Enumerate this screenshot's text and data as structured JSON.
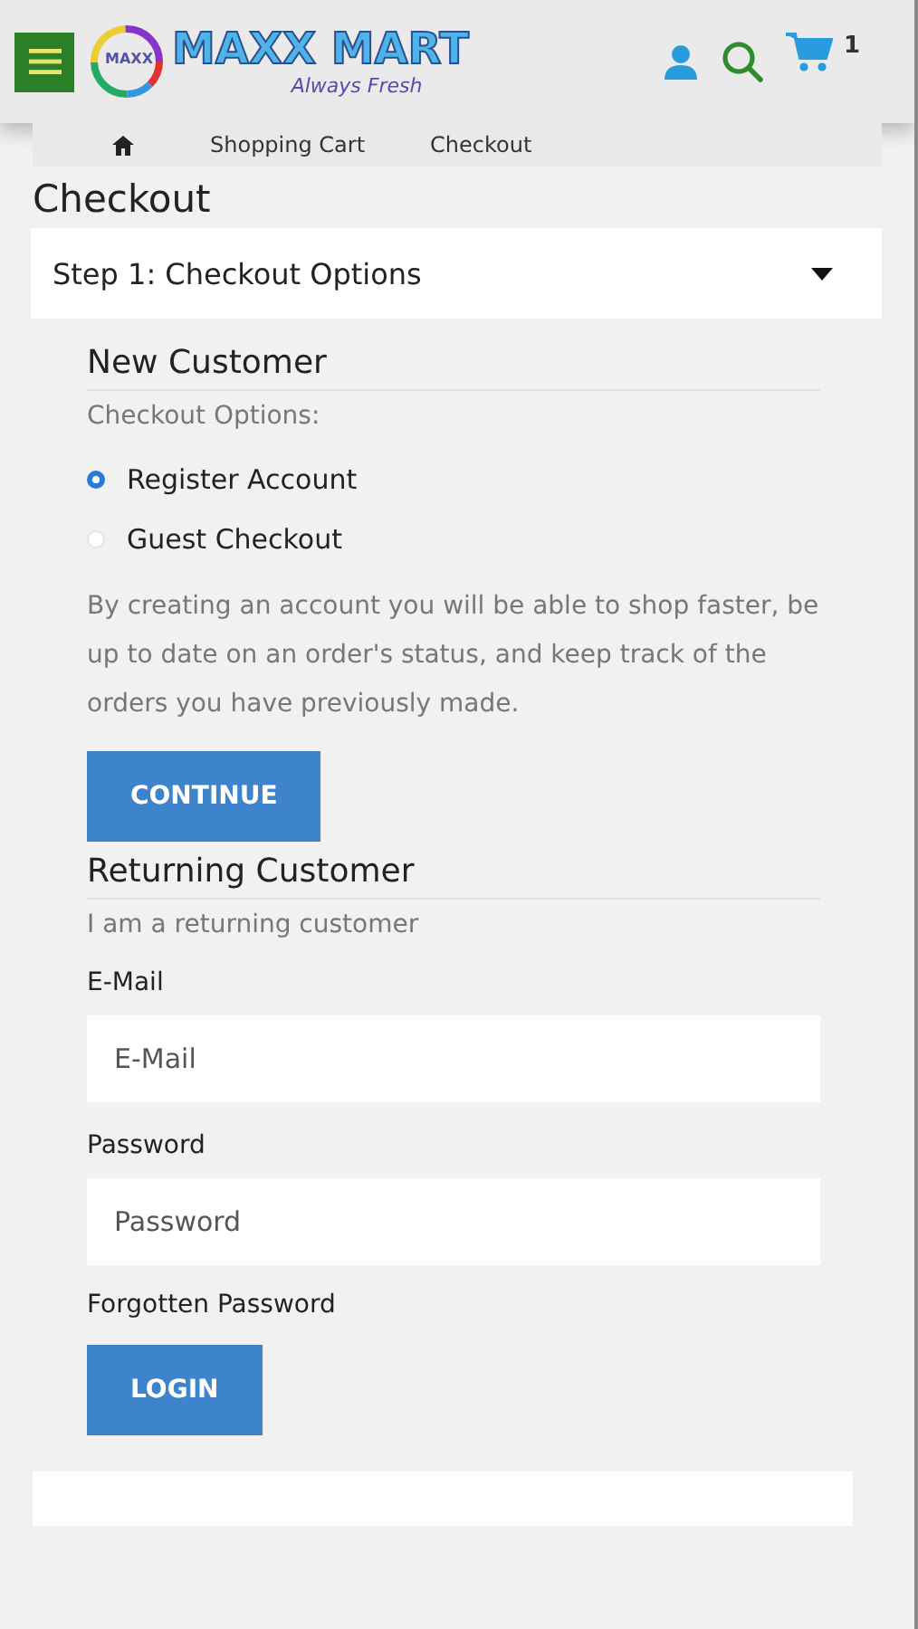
{
  "header": {
    "logo_badge": "MAXX",
    "logo_text": "MAXX MART",
    "tagline": "Always Fresh",
    "cart_count": "1"
  },
  "breadcrumb": [
    "Shopping Cart",
    "Checkout"
  ],
  "page_title": "Checkout",
  "step": {
    "title": "Step 1: Checkout Options",
    "expanded": true
  },
  "new_customer": {
    "heading": "New Customer",
    "subheading": "Checkout Options:",
    "options": [
      {
        "label": "Register Account",
        "selected": true
      },
      {
        "label": "Guest Checkout",
        "selected": false
      }
    ],
    "description": "By creating an account you will be able to shop faster, be up to date on an order's status, and keep track of the orders you have previously made.",
    "button": "CONTINUE"
  },
  "returning_customer": {
    "heading": "Returning Customer",
    "subheading": "I am a returning customer",
    "fields": [
      {
        "label": "E-Mail",
        "placeholder": "E-Mail"
      },
      {
        "label": "Password",
        "placeholder": "Password"
      }
    ],
    "forgot_link": "Forgotten Password",
    "button": "LOGIN"
  }
}
